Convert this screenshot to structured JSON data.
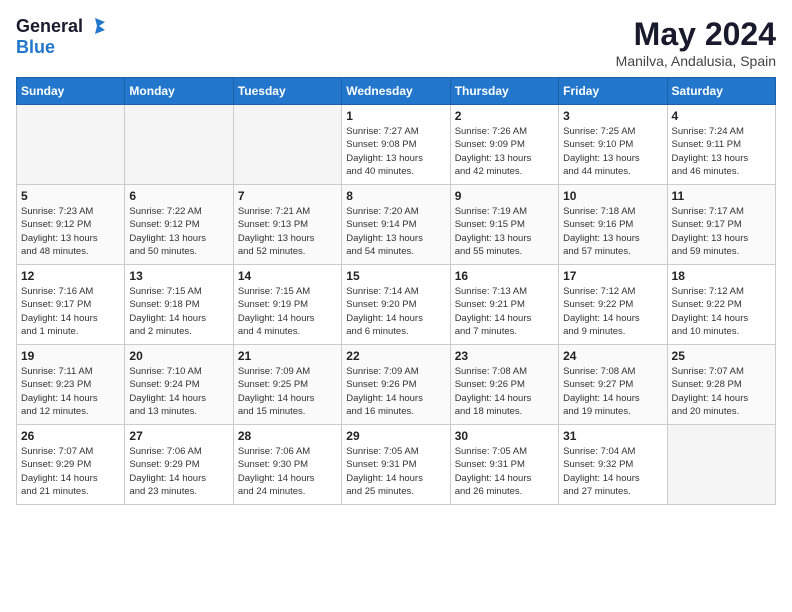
{
  "header": {
    "logo_line1": "General",
    "logo_line2": "Blue",
    "month": "May 2024",
    "location": "Manilva, Andalusia, Spain"
  },
  "days_of_week": [
    "Sunday",
    "Monday",
    "Tuesday",
    "Wednesday",
    "Thursday",
    "Friday",
    "Saturday"
  ],
  "weeks": [
    [
      {
        "day": "",
        "info": "",
        "empty": true
      },
      {
        "day": "",
        "info": "",
        "empty": true
      },
      {
        "day": "",
        "info": "",
        "empty": true
      },
      {
        "day": "1",
        "info": "Sunrise: 7:27 AM\nSunset: 9:08 PM\nDaylight: 13 hours\nand 40 minutes.",
        "empty": false
      },
      {
        "day": "2",
        "info": "Sunrise: 7:26 AM\nSunset: 9:09 PM\nDaylight: 13 hours\nand 42 minutes.",
        "empty": false
      },
      {
        "day": "3",
        "info": "Sunrise: 7:25 AM\nSunset: 9:10 PM\nDaylight: 13 hours\nand 44 minutes.",
        "empty": false
      },
      {
        "day": "4",
        "info": "Sunrise: 7:24 AM\nSunset: 9:11 PM\nDaylight: 13 hours\nand 46 minutes.",
        "empty": false
      }
    ],
    [
      {
        "day": "5",
        "info": "Sunrise: 7:23 AM\nSunset: 9:12 PM\nDaylight: 13 hours\nand 48 minutes.",
        "empty": false
      },
      {
        "day": "6",
        "info": "Sunrise: 7:22 AM\nSunset: 9:12 PM\nDaylight: 13 hours\nand 50 minutes.",
        "empty": false
      },
      {
        "day": "7",
        "info": "Sunrise: 7:21 AM\nSunset: 9:13 PM\nDaylight: 13 hours\nand 52 minutes.",
        "empty": false
      },
      {
        "day": "8",
        "info": "Sunrise: 7:20 AM\nSunset: 9:14 PM\nDaylight: 13 hours\nand 54 minutes.",
        "empty": false
      },
      {
        "day": "9",
        "info": "Sunrise: 7:19 AM\nSunset: 9:15 PM\nDaylight: 13 hours\nand 55 minutes.",
        "empty": false
      },
      {
        "day": "10",
        "info": "Sunrise: 7:18 AM\nSunset: 9:16 PM\nDaylight: 13 hours\nand 57 minutes.",
        "empty": false
      },
      {
        "day": "11",
        "info": "Sunrise: 7:17 AM\nSunset: 9:17 PM\nDaylight: 13 hours\nand 59 minutes.",
        "empty": false
      }
    ],
    [
      {
        "day": "12",
        "info": "Sunrise: 7:16 AM\nSunset: 9:17 PM\nDaylight: 14 hours\nand 1 minute.",
        "empty": false
      },
      {
        "day": "13",
        "info": "Sunrise: 7:15 AM\nSunset: 9:18 PM\nDaylight: 14 hours\nand 2 minutes.",
        "empty": false
      },
      {
        "day": "14",
        "info": "Sunrise: 7:15 AM\nSunset: 9:19 PM\nDaylight: 14 hours\nand 4 minutes.",
        "empty": false
      },
      {
        "day": "15",
        "info": "Sunrise: 7:14 AM\nSunset: 9:20 PM\nDaylight: 14 hours\nand 6 minutes.",
        "empty": false
      },
      {
        "day": "16",
        "info": "Sunrise: 7:13 AM\nSunset: 9:21 PM\nDaylight: 14 hours\nand 7 minutes.",
        "empty": false
      },
      {
        "day": "17",
        "info": "Sunrise: 7:12 AM\nSunset: 9:22 PM\nDaylight: 14 hours\nand 9 minutes.",
        "empty": false
      },
      {
        "day": "18",
        "info": "Sunrise: 7:12 AM\nSunset: 9:22 PM\nDaylight: 14 hours\nand 10 minutes.",
        "empty": false
      }
    ],
    [
      {
        "day": "19",
        "info": "Sunrise: 7:11 AM\nSunset: 9:23 PM\nDaylight: 14 hours\nand 12 minutes.",
        "empty": false
      },
      {
        "day": "20",
        "info": "Sunrise: 7:10 AM\nSunset: 9:24 PM\nDaylight: 14 hours\nand 13 minutes.",
        "empty": false
      },
      {
        "day": "21",
        "info": "Sunrise: 7:09 AM\nSunset: 9:25 PM\nDaylight: 14 hours\nand 15 minutes.",
        "empty": false
      },
      {
        "day": "22",
        "info": "Sunrise: 7:09 AM\nSunset: 9:26 PM\nDaylight: 14 hours\nand 16 minutes.",
        "empty": false
      },
      {
        "day": "23",
        "info": "Sunrise: 7:08 AM\nSunset: 9:26 PM\nDaylight: 14 hours\nand 18 minutes.",
        "empty": false
      },
      {
        "day": "24",
        "info": "Sunrise: 7:08 AM\nSunset: 9:27 PM\nDaylight: 14 hours\nand 19 minutes.",
        "empty": false
      },
      {
        "day": "25",
        "info": "Sunrise: 7:07 AM\nSunset: 9:28 PM\nDaylight: 14 hours\nand 20 minutes.",
        "empty": false
      }
    ],
    [
      {
        "day": "26",
        "info": "Sunrise: 7:07 AM\nSunset: 9:29 PM\nDaylight: 14 hours\nand 21 minutes.",
        "empty": false
      },
      {
        "day": "27",
        "info": "Sunrise: 7:06 AM\nSunset: 9:29 PM\nDaylight: 14 hours\nand 23 minutes.",
        "empty": false
      },
      {
        "day": "28",
        "info": "Sunrise: 7:06 AM\nSunset: 9:30 PM\nDaylight: 14 hours\nand 24 minutes.",
        "empty": false
      },
      {
        "day": "29",
        "info": "Sunrise: 7:05 AM\nSunset: 9:31 PM\nDaylight: 14 hours\nand 25 minutes.",
        "empty": false
      },
      {
        "day": "30",
        "info": "Sunrise: 7:05 AM\nSunset: 9:31 PM\nDaylight: 14 hours\nand 26 minutes.",
        "empty": false
      },
      {
        "day": "31",
        "info": "Sunrise: 7:04 AM\nSunset: 9:32 PM\nDaylight: 14 hours\nand 27 minutes.",
        "empty": false
      },
      {
        "day": "",
        "info": "",
        "empty": true
      }
    ]
  ]
}
